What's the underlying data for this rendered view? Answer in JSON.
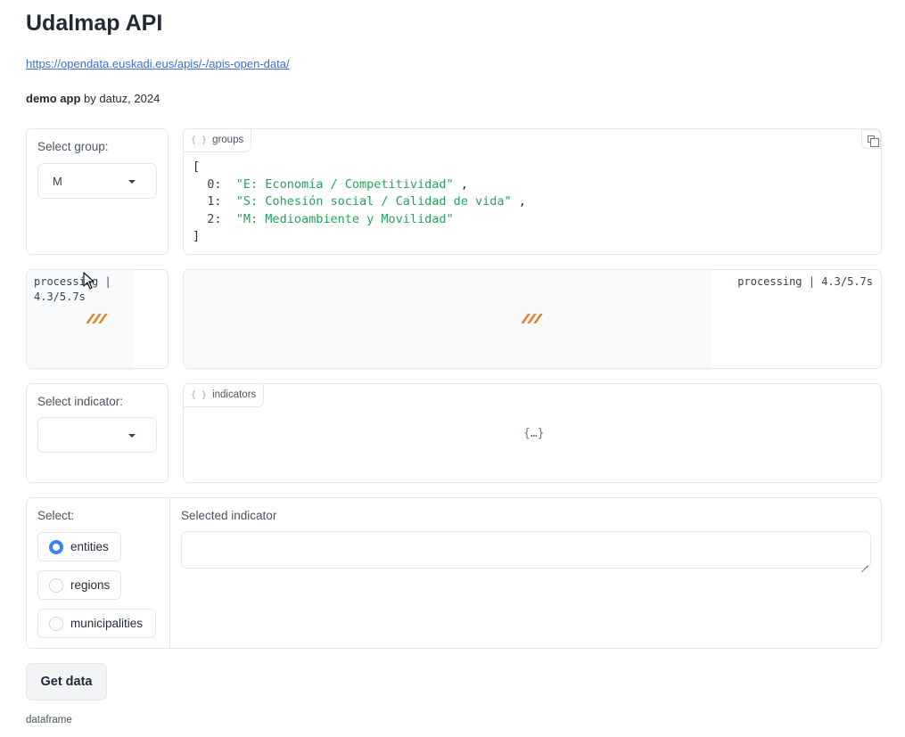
{
  "header": {
    "title": "Udalmap API",
    "link": "https://opendata.euskadi.eus/apis/-/apis-open-data/",
    "credits_bold": "demo app",
    "credits_rest": " by datuz, 2024"
  },
  "group_select": {
    "label": "Select group:",
    "value": "M"
  },
  "groups_json": {
    "tag": "groups",
    "open": "[",
    "close": "]",
    "items": [
      {
        "key": "0:",
        "value": "\"E: Economía / Competitividad\"",
        "sep": " ,"
      },
      {
        "key": "1:",
        "value": "\"S: Cohesión social / Calidad de vida\"",
        "sep": " ,"
      },
      {
        "key": "2:",
        "value": "\"M: Medioambiente y Movilidad\"",
        "sep": ""
      }
    ]
  },
  "processing": {
    "left_line1": "processing |",
    "left_line2": "4.3/5.7s",
    "right": "processing | 4.3/5.7s"
  },
  "indicator_select": {
    "label": "Select indicator:",
    "value": ""
  },
  "indicators_json": {
    "tag": "indicators",
    "placeholder": "{…}"
  },
  "level_radio": {
    "label": "Select:",
    "options": [
      {
        "label": "entities",
        "selected": true
      },
      {
        "label": "regions",
        "selected": false
      },
      {
        "label": "municipalities",
        "selected": false
      }
    ]
  },
  "selected_indicator": {
    "label": "Selected indicator",
    "value": ""
  },
  "actions": {
    "get_data": "Get data"
  },
  "output": {
    "dataframe_label": "dataframe"
  },
  "colors": {
    "accent": "#3b82f6",
    "string": "#22a45d",
    "spinner": "#e0802b"
  }
}
